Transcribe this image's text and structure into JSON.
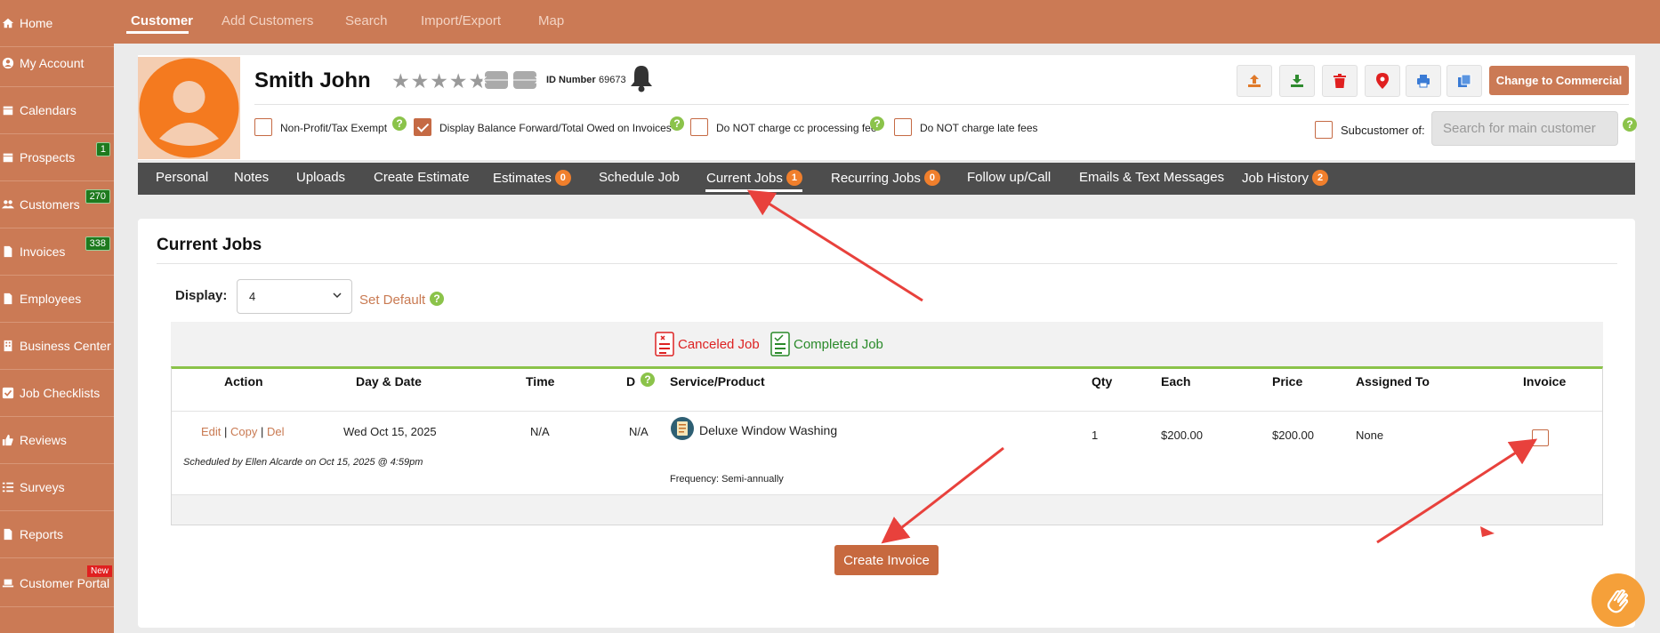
{
  "sidebar": {
    "items": [
      {
        "label": "Home",
        "icon": "home-icon",
        "badge": ""
      },
      {
        "label": "My Account",
        "icon": "user-circle-icon",
        "badge": ""
      },
      {
        "label": "Calendars",
        "icon": "calendar-icon",
        "badge": ""
      },
      {
        "label": "Prospects",
        "icon": "calendar-icon",
        "badge": "1"
      },
      {
        "label": "Customers",
        "icon": "users-icon",
        "badge": "270"
      },
      {
        "label": "Invoices",
        "icon": "file-icon",
        "badge": "338"
      },
      {
        "label": "Employees",
        "icon": "file-icon",
        "badge": ""
      },
      {
        "label": "Business Center",
        "icon": "building-icon",
        "badge": ""
      },
      {
        "label": "Job Checklists",
        "icon": "check-square-icon",
        "badge": ""
      },
      {
        "label": "Reviews",
        "icon": "thumbs-up-icon",
        "badge": ""
      },
      {
        "label": "Surveys",
        "icon": "list-icon",
        "badge": ""
      },
      {
        "label": "Reports",
        "icon": "file-icon",
        "badge": ""
      },
      {
        "label": "Customer Portal",
        "icon": "laptop-icon",
        "badge": "New"
      }
    ]
  },
  "topnav": {
    "items": [
      "Customer",
      "Add Customers",
      "Search",
      "Import/Export",
      "Map"
    ],
    "active": "Customer"
  },
  "customer": {
    "name": "Smith John",
    "rating": 0,
    "id_label": "ID Number",
    "id_value": "69673",
    "change_button": "Change to Commercial"
  },
  "options": {
    "nonprofit": "Non-Profit/Tax Exempt",
    "balance_forward": "Display Balance Forward/Total Owed on Invoices",
    "no_cc_fee": "Do NOT charge cc processing fee",
    "no_late_fees": "Do NOT charge late fees",
    "subcustomer_label": "Subcustomer of:",
    "subcustomer_placeholder": "Search for main customer"
  },
  "tabs": [
    {
      "label": "Personal",
      "badge": ""
    },
    {
      "label": "Notes",
      "badge": ""
    },
    {
      "label": "Uploads",
      "badge": ""
    },
    {
      "label": "Create Estimate",
      "badge": ""
    },
    {
      "label": "Estimates",
      "badge": "0"
    },
    {
      "label": "Schedule Job",
      "badge": ""
    },
    {
      "label": "Current Jobs",
      "badge": "1"
    },
    {
      "label": "Recurring Jobs",
      "badge": "0"
    },
    {
      "label": "Follow up/Call",
      "badge": ""
    },
    {
      "label": "Emails & Text Messages",
      "badge": ""
    },
    {
      "label": "Job History",
      "badge": "2"
    }
  ],
  "section": {
    "title": "Current Jobs",
    "display_label": "Display:",
    "display_value": "4",
    "set_default": "Set Default",
    "canceled_legend": "Canceled Job",
    "completed_legend": "Completed Job"
  },
  "table": {
    "headers": [
      "Action",
      "Day & Date",
      "Time",
      "D",
      "Service/Product",
      "Qty",
      "Each",
      "Price",
      "Assigned To",
      "Invoice"
    ],
    "row": {
      "edit": "Edit",
      "copy": "Copy",
      "del": "Del",
      "sep": "|",
      "date": "Wed Oct 15, 2025",
      "time": "N/A",
      "d": "N/A",
      "service": "Deluxe Window Washing",
      "qty": "1",
      "each": "$200.00",
      "price": "$200.00",
      "assigned": "None",
      "scheduled_by": "Scheduled by Ellen Alcarde on Oct 15, 2025 @ 4:59pm",
      "frequency": "Frequency: Semi-annually"
    }
  },
  "create_invoice": "Create Invoice",
  "colors": {
    "brand": "#cb7a55",
    "tabbar": "#4d4d4d",
    "badge": "#f07f2c",
    "help": "#8bc34a",
    "annotation": "#e8413c"
  }
}
